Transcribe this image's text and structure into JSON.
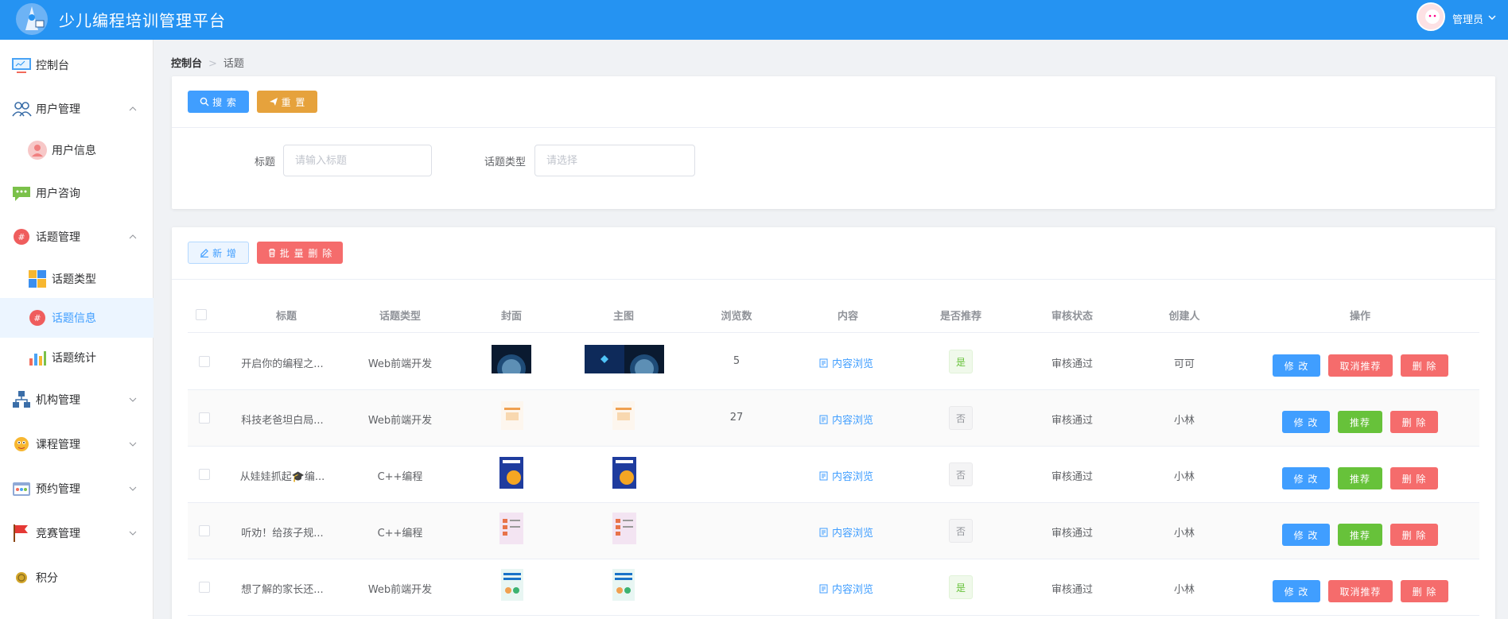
{
  "header": {
    "title": "少儿编程培训管理平台",
    "user": "管理员"
  },
  "sidebar": {
    "items": [
      {
        "label": "控制台",
        "icon": "monitor-icon"
      },
      {
        "label": "用户管理",
        "icon": "users-icon",
        "expanded": true
      },
      {
        "label": "用户信息",
        "icon": "user-avatar-icon",
        "sub": true
      },
      {
        "label": "用户咨询",
        "icon": "chat-icon"
      },
      {
        "label": "话题管理",
        "icon": "hashtag-icon",
        "expanded": true
      },
      {
        "label": "话题类型",
        "icon": "blocks-icon",
        "sub": true
      },
      {
        "label": "话题信息",
        "icon": "hashtag-icon",
        "sub": true,
        "active": true
      },
      {
        "label": "话题统计",
        "icon": "bar-chart-icon",
        "sub": true
      },
      {
        "label": "机构管理",
        "icon": "org-icon"
      },
      {
        "label": "课程管理",
        "icon": "mascot-icon"
      },
      {
        "label": "预约管理",
        "icon": "calendar-icon"
      },
      {
        "label": "竞赛管理",
        "icon": "flag-icon"
      },
      {
        "label": "积分",
        "icon": "coin-icon"
      }
    ]
  },
  "breadcrumb": {
    "home": "控制台",
    "current": "话题"
  },
  "search_panel": {
    "search_button": "搜 索",
    "reset_button": "重 置",
    "title_label": "标题",
    "title_placeholder": "请输入标题",
    "type_label": "话题类型",
    "type_placeholder": "请选择"
  },
  "toolbar": {
    "add_button": "新 增",
    "batch_delete_button": "批 量 删 除"
  },
  "table": {
    "columns": [
      "标题",
      "话题类型",
      "封面",
      "主图",
      "浏览数",
      "内容",
      "是否推荐",
      "审核状态",
      "创建人",
      "操作"
    ],
    "content_link": "内容浏览",
    "action_edit": "修 改",
    "action_delete": "删 除",
    "action_recommend": "推荐",
    "action_unrecommend": "取消推荐",
    "rows": [
      {
        "title": "开启你的编程之...",
        "type": "Web前端开发",
        "views": "5",
        "recommended": "是",
        "status": "审核通过",
        "creator": "可可"
      },
      {
        "title": "科技老爸坦白局...",
        "type": "Web前端开发",
        "views": "27",
        "recommended": "否",
        "status": "审核通过",
        "creator": "小林"
      },
      {
        "title": "从娃娃抓起🎓编...",
        "type": "C++编程",
        "views": "",
        "recommended": "否",
        "status": "审核通过",
        "creator": "小林"
      },
      {
        "title": "听劝！给孩子规...",
        "type": "C++编程",
        "views": "",
        "recommended": "否",
        "status": "审核通过",
        "creator": "小林"
      },
      {
        "title": "想了解的家长还...",
        "type": "Web前端开发",
        "views": "",
        "recommended": "是",
        "status": "审核通过",
        "creator": "小林"
      }
    ]
  },
  "colors": {
    "header": "#2593f2",
    "primary": "#409eff",
    "danger": "#f56c6c",
    "success": "#67c23a",
    "warning": "#e6a23c"
  }
}
